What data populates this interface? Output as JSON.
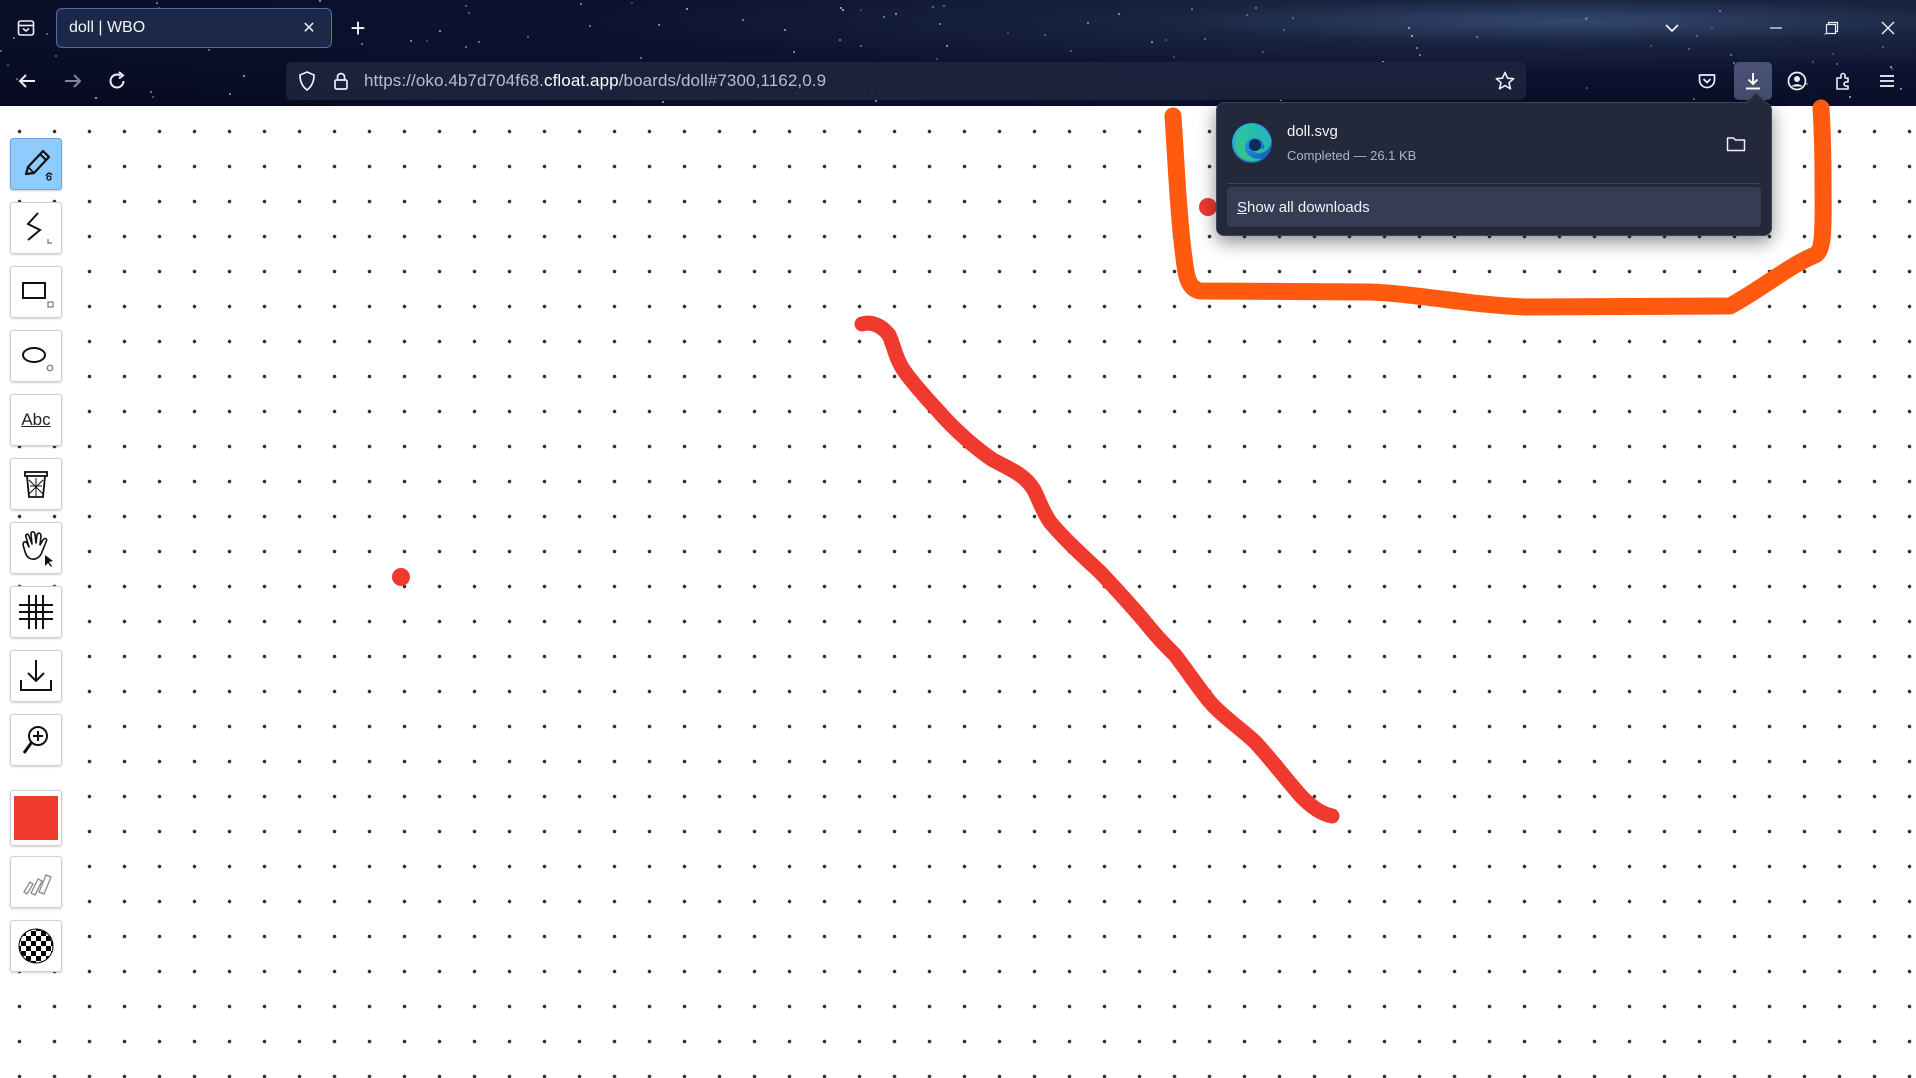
{
  "browser": {
    "tab": {
      "title": "doll | WBO",
      "close_glyph": "✕"
    },
    "new_tab_glyph": "+",
    "tab_list_glyph": "⌄",
    "window": {
      "minimize_glyph": "—",
      "restore_glyph": "❐",
      "close_glyph": "✕"
    },
    "url": {
      "prefix": "https://oko.4b7d704f68.",
      "domain": "cfloat.app",
      "path": "/boards/doll#7300,1162,0.9"
    },
    "nav_icons": [
      "back-icon",
      "forward-icon",
      "reload-icon",
      "tracking-shield-icon",
      "lock-icon",
      "bookmark-star-icon",
      "pocket-icon",
      "downloads-icon",
      "account-icon",
      "extensions-icon",
      "menu-icon"
    ]
  },
  "downloads_panel": {
    "file_name": "doll.svg",
    "status": "Completed — 26.1 KB",
    "show_all_label": "Show all downloads",
    "show_all_access_key": "S",
    "show_all_rest": "how all downloads"
  },
  "toolbar": {
    "tools": [
      {
        "name": "pencil",
        "icon": "pencil-icon",
        "active": true
      },
      {
        "name": "line",
        "icon": "line-icon",
        "active": false
      },
      {
        "name": "rectangle",
        "icon": "rectangle-icon",
        "active": false
      },
      {
        "name": "ellipse",
        "icon": "ellipse-icon",
        "active": false
      },
      {
        "name": "text",
        "icon": "text-icon",
        "label": "Abc",
        "active": false
      },
      {
        "name": "eraser",
        "icon": "trash-icon",
        "active": false
      },
      {
        "name": "hand",
        "icon": "hand-icon",
        "active": false
      },
      {
        "name": "grid",
        "icon": "grid-icon",
        "active": false
      },
      {
        "name": "download",
        "icon": "download-icon",
        "active": false
      },
      {
        "name": "zoom",
        "icon": "zoom-icon",
        "active": false
      },
      {
        "name": "color",
        "icon": "color-swatch",
        "active": false
      },
      {
        "name": "size",
        "icon": "pencils-icon",
        "active": false
      },
      {
        "name": "opacity",
        "icon": "checkerboard-icon",
        "active": false
      }
    ],
    "current_color": "#f03a2e"
  },
  "canvas": {
    "pen_color": "#f03a2e",
    "highlight_color": "#ff5a10"
  }
}
